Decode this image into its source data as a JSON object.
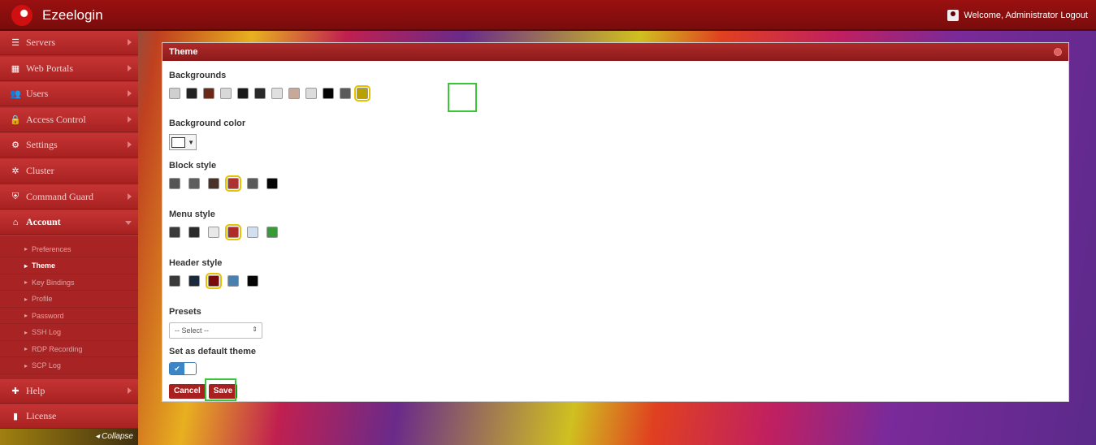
{
  "app": {
    "title": "Ezeelogin",
    "user_text": "Welcome, Administrator Logout"
  },
  "sidebar": {
    "items": [
      {
        "label": "Servers",
        "icon": "list-icon"
      },
      {
        "label": "Web Portals",
        "icon": "grid-icon"
      },
      {
        "label": "Users",
        "icon": "users-icon"
      },
      {
        "label": "Access Control",
        "icon": "lock-icon"
      },
      {
        "label": "Settings",
        "icon": "gears-icon"
      },
      {
        "label": "Cluster",
        "icon": "cluster-icon"
      },
      {
        "label": "Command Guard",
        "icon": "shield-icon"
      },
      {
        "label": "Account",
        "icon": "home-icon"
      }
    ],
    "submenu": [
      "Preferences",
      "Theme",
      "Key Bindings",
      "Profile",
      "Password",
      "SSH Log",
      "RDP Recording",
      "SCP Log"
    ],
    "bottom_items": [
      {
        "label": "Help",
        "icon": "help-icon"
      },
      {
        "label": "License",
        "icon": "license-icon"
      }
    ],
    "collapse_label": "◂ Collapse"
  },
  "panel": {
    "title": "Theme",
    "backgrounds": {
      "label": "Backgrounds",
      "colors": [
        "#cfcfcf",
        "#222222",
        "#6b2a18",
        "#d8d8d8",
        "#1a1a1a",
        "#2a2a2a",
        "#e0e0e0",
        "#c8a898",
        "#dcdcdc",
        "#050505",
        "#5a5a5a",
        "#b8a000"
      ]
    },
    "background_color": {
      "label": "Background color"
    },
    "block_style": {
      "label": "Block style",
      "colors": [
        "#555555",
        "#5e5e5e",
        "#4a3026",
        "#b03030",
        "#5a5a5a",
        "#050505"
      ]
    },
    "menu_style": {
      "label": "Menu style",
      "colors": [
        "#3a3a3a",
        "#2a2a2a",
        "#e8e8e8",
        "#b02a2a",
        "#d0e0f0",
        "#3a9a3a"
      ]
    },
    "header_style": {
      "label": "Header style",
      "colors": [
        "#3a3a3a",
        "#1a2a3a",
        "#7a0c0c",
        "#4a80b0",
        "#050505"
      ]
    },
    "presets": {
      "label": "Presets",
      "select_value": "-- Select --"
    },
    "default_theme": {
      "label": "Set as default theme",
      "toggle_on": "✔"
    },
    "buttons": {
      "cancel": "Cancel",
      "save": "Save"
    }
  }
}
